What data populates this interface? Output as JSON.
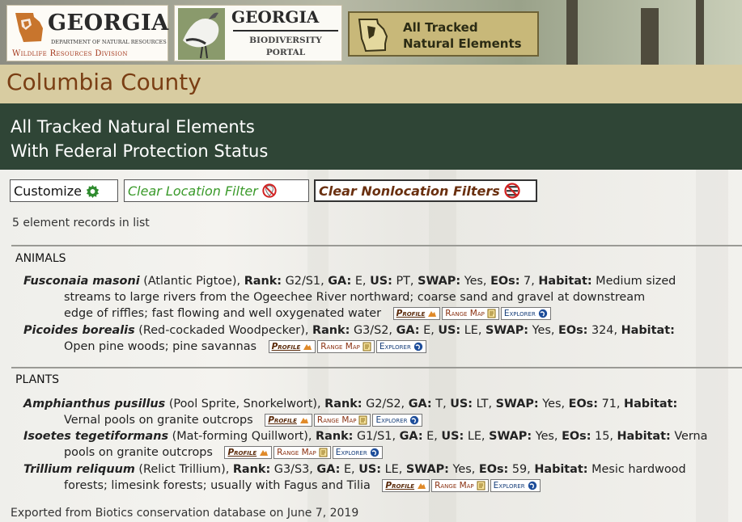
{
  "banner": {
    "dnr_logo": {
      "title": "GEORGIA",
      "subtitle": "DEPARTMENT OF NATURAL RESOURCES",
      "division": "Wildlife Resources Division"
    },
    "portal_logo": {
      "title": "GEORGIA",
      "line1": "BIODIVERSITY",
      "line2": "PORTAL"
    },
    "report_logo": {
      "line1": "All Tracked",
      "line2": "Natural Elements"
    }
  },
  "page": {
    "county": "Columbia County",
    "report_title_line1": "All Tracked Natural Elements",
    "report_title_line2": "With Federal Protection Status"
  },
  "toolbar": {
    "customize": "Customize",
    "clear_location": "Clear Location Filter",
    "clear_nonlocation": "Clear Nonlocation Filters"
  },
  "record_count": "5 element records in list",
  "field_labels": {
    "rank": "Rank:",
    "ga": "GA:",
    "us": "US:",
    "swap": "SWAP:",
    "eos": "EOs:",
    "habitat": "Habitat:"
  },
  "link_labels": {
    "profile": "Profile",
    "range_map": "Range Map",
    "explorer": "Explorer"
  },
  "sections": [
    {
      "name": "ANIMALS",
      "records": [
        {
          "scientific": "Fusconaia masoni",
          "common": "(Atlantic Pigtoe),",
          "rank": "G2/S1,",
          "ga": "E,",
          "us": "PT,",
          "swap": "Yes,",
          "eos": "7,",
          "habitat_1": "Medium sized",
          "habitat_2": "streams to large rivers from the Ogeechee River northward; coarse sand and gravel at downstream",
          "habitat_3": "edge of riffles; fast flowing and well oxygenated water"
        },
        {
          "scientific": "Picoides borealis",
          "common": "(Red-cockaded Woodpecker),",
          "rank": "G3/S2,",
          "ga": "E,",
          "us": "LE,",
          "swap": "Yes,",
          "eos": "324,",
          "habitat_1": "",
          "habitat_2": "Open pine woods; pine savannas"
        }
      ]
    },
    {
      "name": "PLANTS",
      "records": [
        {
          "scientific": "Amphianthus pusillus",
          "common": "(Pool Sprite, Snorkelwort),",
          "rank": "G2/S2,",
          "ga": "T,",
          "us": "LT,",
          "swap": "Yes,",
          "eos": "71,",
          "habitat_1": "",
          "habitat_2": "Vernal pools on granite outcrops"
        },
        {
          "scientific": "Isoetes tegetiformans",
          "common": "(Mat-forming Quillwort),",
          "rank": "G1/S1,",
          "ga": "E,",
          "us": "LE,",
          "swap": "Yes,",
          "eos": "15,",
          "habitat_1": "Verna",
          "habitat_2": "pools on granite outcrops"
        },
        {
          "scientific": "Trillium reliquum",
          "common": "(Relict Trillium),",
          "rank": "G3/S3,",
          "ga": "E,",
          "us": "LE,",
          "swap": "Yes,",
          "eos": "59,",
          "habitat_1": "Mesic hardwood",
          "habitat_2": "forests; limesink forests; usually with Fagus and Tilia"
        }
      ]
    }
  ],
  "footer": "Exported from Biotics conservation database on June 7, 2019",
  "colors": {
    "county_bar": "#d8cca1",
    "county_text": "#7a3e14",
    "report_bar": "#2f4536",
    "clear_location_green": "#3a9a2a"
  }
}
